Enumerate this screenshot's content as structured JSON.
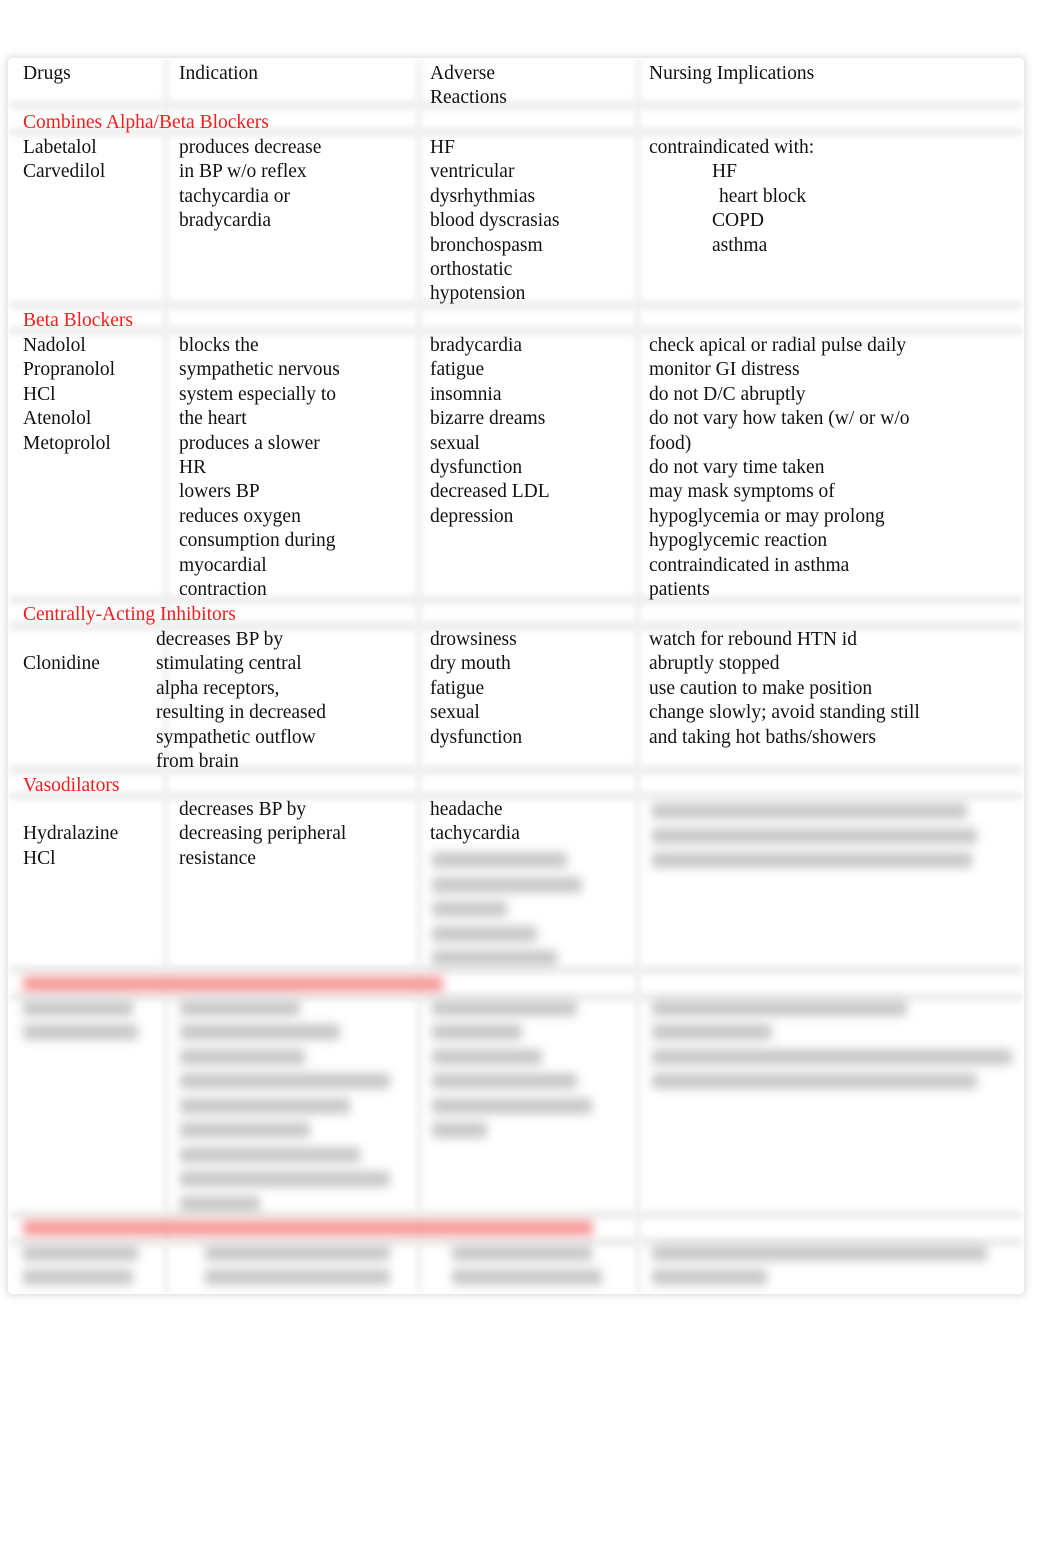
{
  "header": {
    "drugs": "Drugs",
    "indication": "Indication",
    "adverse": "Adverse\nReactions",
    "nursing": "Nursing Implications"
  },
  "sections": [
    {
      "title": "Combines Alpha/Beta Blockers",
      "drugs": " Labetalol\n Carvedilol",
      "indication": " produces decrease\nin BP w/o reflex\ntachycardia or\nbradycardia",
      "adverse": " HF\n ventricular\ndysrhythmias\n blood dyscrasias\n bronchospasm\n orthostatic\nhypotension",
      "nursing_intro": " contraindicated with:",
      "nursing_items": [
        " HF",
        " heart block",
        " COPD",
        " asthma"
      ]
    },
    {
      "title": "Beta Blockers",
      "drugs": " Nadolol\n Propranolol\nHCl\n Atenolol\n Metoprolol",
      "indication": " blocks the\nsympathetic nervous\nsystem especially to\nthe heart\n produces a slower\nHR\n lowers BP\n reduces oxygen\nconsumption during\nmyocardial\ncontraction",
      "adverse": " bradycardia\n fatigue\n insomnia\n bizarre dreams\n sexual\ndysfunction\n decreased LDL\n depression",
      "nursing": " check apical or radial pulse daily\n monitor GI distress\n do not D/C abruptly\n do not vary how taken (w/ or w/o\nfood)\n do not vary time taken\n may mask symptoms of\nhypoglycemia or may prolong\nhypoglycemic reaction\n contraindicated in asthma\npatients"
    },
    {
      "title": "Centrally-Acting Inhibitors",
      "drugs": "\nClonidine",
      "indication": " decreases BP by\nstimulating central\nalpha receptors,\nresulting in decreased\nsympathetic outflow\nfrom brain",
      "adverse": " drowsiness\n dry mouth\n fatigue\n sexual\ndysfunction",
      "nursing": " watch for rebound HTN id\nabruptly stopped\n use caution to make position\nchange slowly; avoid standing still\nand taking hot baths/showers"
    },
    {
      "title": "Vasodilators",
      "drugs": "\nHydralazine\nHCl",
      "indication": " decreases BP by\ndecreasing peripheral\nresistance",
      "adverse": " headache\n tachycardia"
    }
  ],
  "colors": {
    "section_title": "#ff1a1a",
    "text": "#111111"
  }
}
